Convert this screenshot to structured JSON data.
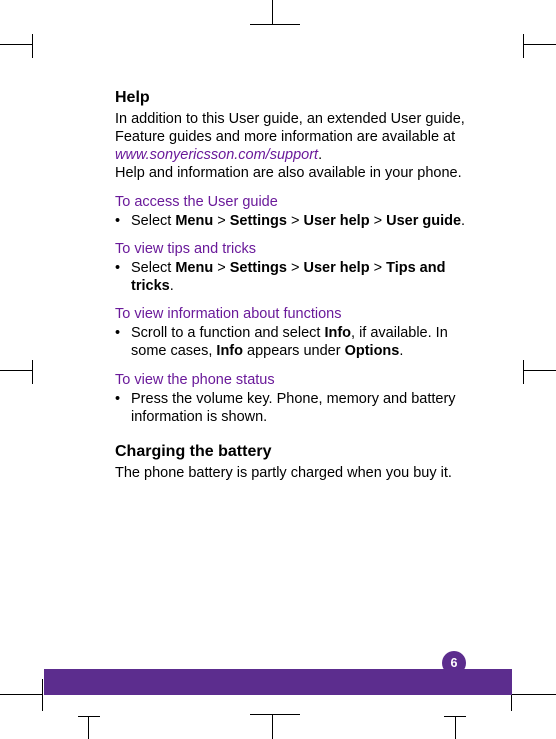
{
  "help": {
    "heading": "Help",
    "intro1": "In addition to this User guide, an extended User guide, Feature guides and more information are available at",
    "link": "www.sonyericsson.com/support",
    "intro2": "Help and information are also available in your phone."
  },
  "sections": {
    "accessUserGuide": {
      "title": "To access the User guide",
      "bullet_pre": "Select ",
      "path": [
        "Menu",
        "Settings",
        "User help",
        "User guide"
      ]
    },
    "tipsTricks": {
      "title": "To view tips and tricks",
      "bullet_pre": "Select ",
      "path": [
        "Menu",
        "Settings",
        "User help",
        "Tips and tricks"
      ]
    },
    "functions": {
      "title": "To view information about functions",
      "text_a": "Scroll to a function and select ",
      "bold_a": "Info",
      "text_b": ", if available. In some cases, ",
      "bold_b": "Info",
      "text_c": " appears under ",
      "bold_c": "Options",
      "text_d": "."
    },
    "status": {
      "title": "To view the phone status",
      "text": "Press the volume key. Phone, memory and battery information is shown."
    }
  },
  "charging": {
    "heading": "Charging the battery",
    "text": "The phone battery is partly charged when you buy it."
  },
  "sep": " > ",
  "pageNumber": "6"
}
